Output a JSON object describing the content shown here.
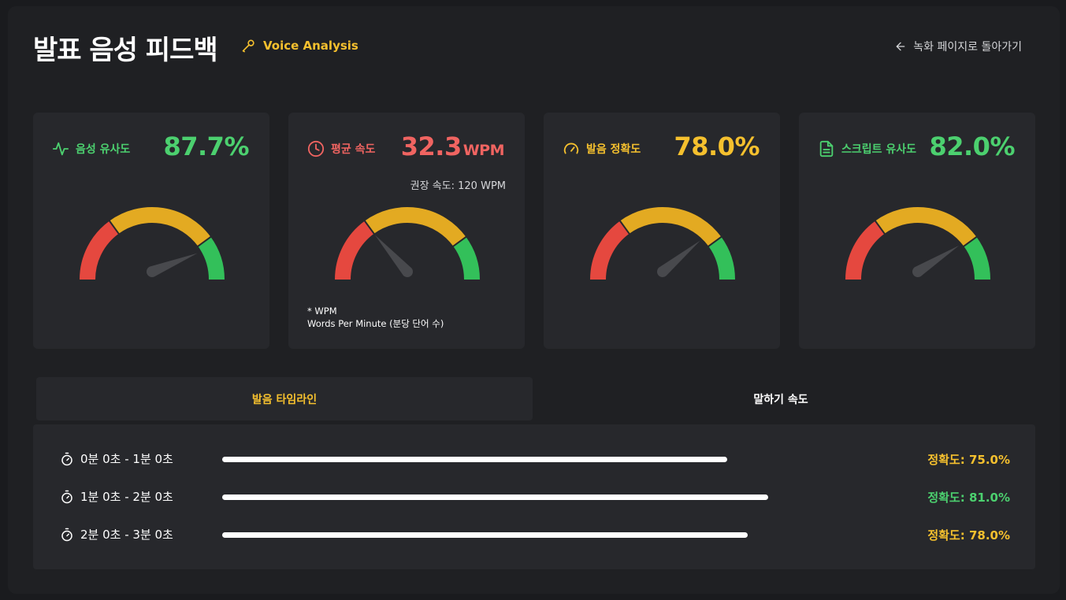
{
  "header": {
    "title": "발표 음성 피드백",
    "brand": "Voice Analysis",
    "back_link": "녹화 페이지로 돌아가기"
  },
  "cards": [
    {
      "label": "음성 유사도",
      "icon": "activity-icon",
      "value": "87.7%",
      "unit": "",
      "note": "",
      "color": "#4cd06f",
      "level": 87.7
    },
    {
      "label": "평균 속도",
      "icon": "clock-icon",
      "value": "32.3",
      "unit": "WPM",
      "note": "권장 속도: 120 WPM",
      "color": "#f06461",
      "level": 27
    },
    {
      "label": "발음 정확도",
      "icon": "gauge-icon",
      "value": "78.0%",
      "unit": "",
      "note": "",
      "color": "#f5c02e",
      "level": 78.0
    },
    {
      "label": "스크립트 유사도",
      "icon": "document-icon",
      "value": "82.0%",
      "unit": "",
      "note": "",
      "color": "#4cd06f",
      "level": 82.0
    }
  ],
  "footnote": {
    "line1": "* WPM",
    "line2": "Words Per Minute (분당 단어 수)"
  },
  "tabs": [
    {
      "label": "발음 타임라인",
      "active": true
    },
    {
      "label": "말하기 속도",
      "active": false
    }
  ],
  "timeline": [
    {
      "range": "0분 0초 - 1분 0초",
      "accuracy_label": "정확도: 75.0%",
      "accuracy": 75.0,
      "color": "#f5c02e"
    },
    {
      "range": "1분 0초 - 2분 0초",
      "accuracy_label": "정확도: 81.0%",
      "accuracy": 81.0,
      "color": "#4cd06f"
    },
    {
      "range": "2분 0초 - 3분 0초",
      "accuracy_label": "정확도: 78.0%",
      "accuracy": 78.0,
      "color": "#f5c02e"
    }
  ],
  "colors": {
    "gauge_red": "#e5483f",
    "gauge_yellow": "#e3aa22",
    "gauge_green": "#33c05a",
    "needle": "#48494d"
  }
}
